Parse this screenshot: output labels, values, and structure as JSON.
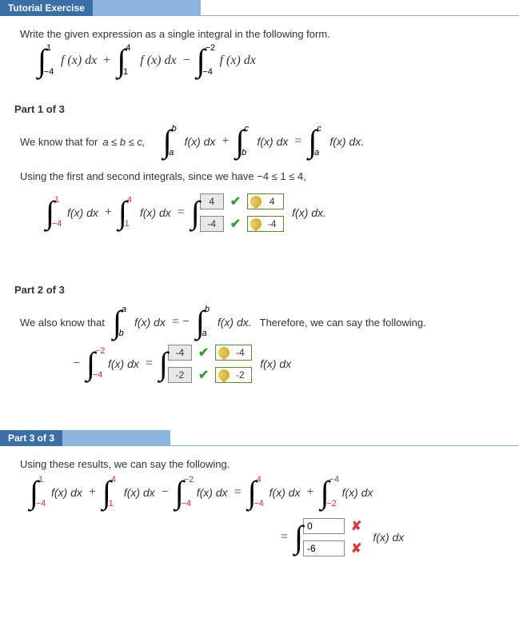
{
  "header": {
    "tutorial": "Tutorial Exercise"
  },
  "prompt": "Write the given expression as a single integral in the following form.",
  "expr": {
    "int1": {
      "lower": "−4",
      "upper": "1",
      "body": "f (x) dx"
    },
    "plus": "+",
    "int2": {
      "lower": "1",
      "upper": "4",
      "body": "f (x) dx"
    },
    "minus": "−",
    "int3": {
      "lower": "−4",
      "upper": "−2",
      "body": "f (x) dx"
    }
  },
  "part1": {
    "title": "Part 1 of 3",
    "line1a": "We know that for  ",
    "ineq": "a ≤ b ≤ c,",
    "rule": {
      "int1": {
        "lower": "a",
        "upper": "b",
        "body": "f(x) dx"
      },
      "int2": {
        "lower": "b",
        "upper": "c",
        "body": "f(x) dx"
      },
      "int3": {
        "lower": "a",
        "upper": "c",
        "body": "f(x) dx."
      }
    },
    "line2": "Using the first and second integrals, since we have −4 ≤ 1 ≤ 4,",
    "work": {
      "int1": {
        "lower": "−4",
        "upper": "1",
        "body": "f(x) dx"
      },
      "int2": {
        "lower": "1",
        "upper": "4",
        "body": "f(x) dx"
      },
      "ans_upper_gray": "4",
      "ans_upper_reveal": "4",
      "ans_lower_gray": "-4",
      "ans_lower_reveal": "-4",
      "tail": "f(x) dx."
    }
  },
  "part2": {
    "title": "Part 2 of 3",
    "line1": "We also know that",
    "rule": {
      "intL": {
        "lower": "b",
        "upper": "a",
        "body": "f(x) dx"
      },
      "intR": {
        "lower": "a",
        "upper": "b",
        "body": "f(x) dx."
      }
    },
    "line1b": "Therefore, we can say the following.",
    "work": {
      "intL": {
        "lower": "−4",
        "upper": "−2",
        "body": "f(x) dx"
      },
      "ans_upper_gray": "-4",
      "ans_upper_reveal": "-4",
      "ans_lower_gray": "-2",
      "ans_lower_reveal": "-2",
      "tail": "f(x) dx"
    }
  },
  "part3": {
    "title": "Part 3 of 3",
    "line1": "Using these results, we can say the following.",
    "lhs": {
      "int1": {
        "lower": "−4",
        "upper": "1",
        "body": "f(x) dx"
      },
      "int2": {
        "lower": "1",
        "upper": "4",
        "body": "f(x) dx"
      },
      "int3": {
        "lower": "−4",
        "upper": "−2",
        "body": "f(x) dx"
      }
    },
    "rhs": {
      "int1": {
        "lower": "−4",
        "upper": "4",
        "body": "f(x) dx"
      },
      "int2": {
        "lower": "−2",
        "upper": "−4",
        "body": "f(x) dx"
      }
    },
    "final": {
      "upper_input": "0",
      "lower_input": "-6",
      "tail": "f(x) dx"
    }
  }
}
